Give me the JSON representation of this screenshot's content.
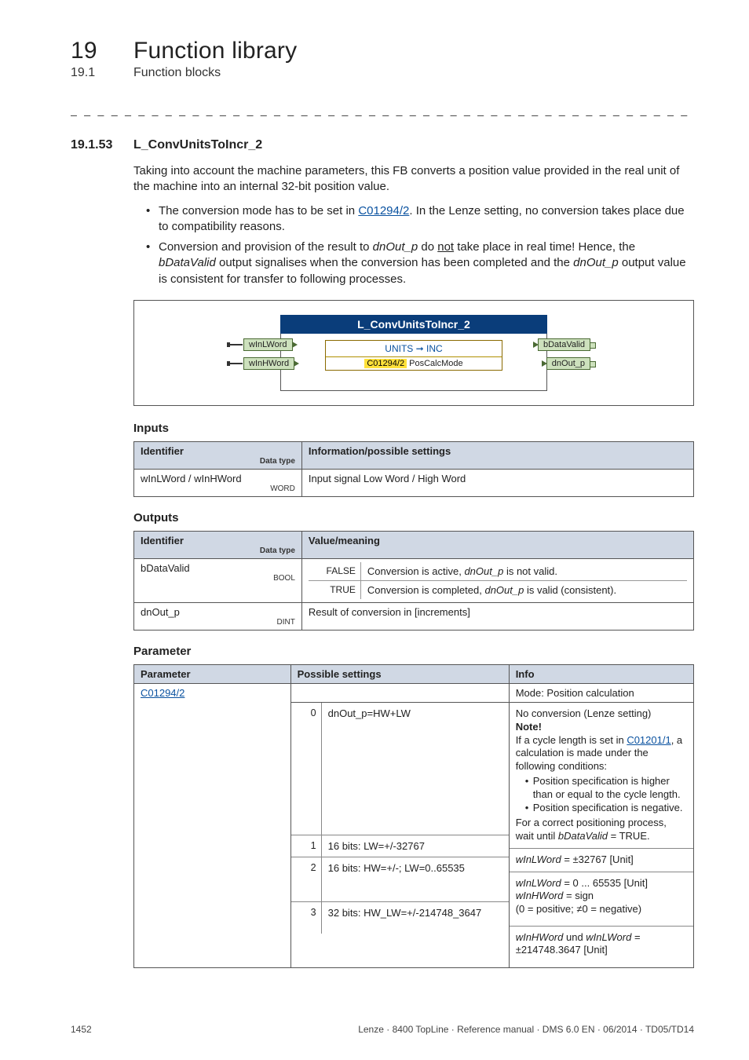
{
  "header": {
    "chapter_num": "19",
    "chapter_title": "Function library",
    "sub_num": "19.1",
    "sub_title": "Function blocks"
  },
  "section": {
    "num": "19.1.53",
    "title": "L_ConvUnitsToIncr_2",
    "intro": "Taking into account the machine parameters, this FB converts a position value provided in the real unit of the machine into an internal 32-bit position value.",
    "bullets": [
      {
        "pre": "The conversion mode has to be set in ",
        "link": "C01294/2",
        "post": ". In the Lenze setting, no conversion takes place due to compatibility reasons."
      },
      {
        "text_full": "Conversion and provision of the result to dnOut_p do not take place in real time! Hence, the bDataValid output signalises when the conversion has been completed and the dnOut_p output value is consistent for transfer to following processes."
      }
    ]
  },
  "diagram": {
    "title": "L_ConvUnitsToIncr_2",
    "in1": "wInLWord",
    "in2": "wInHWord",
    "out1": "bDataValid",
    "out2": "dnOut_p",
    "mid_top": "UNITS ➞ INC",
    "mid_code": "C01294/2",
    "mid_label": "PosCalcMode"
  },
  "inputs": {
    "heading": "Inputs",
    "col1": "Identifier",
    "col1_sub": "Data type",
    "col2": "Information/possible settings",
    "rows": [
      {
        "id": "wInLWord / wInHWord",
        "type": "WORD",
        "info": "Input signal Low Word / High Word"
      }
    ]
  },
  "outputs": {
    "heading": "Outputs",
    "col1": "Identifier",
    "col1_sub": "Data type",
    "col2": "Value/meaning",
    "rows": [
      {
        "id": "bDataValid",
        "type": "BOOL",
        "pairs": [
          {
            "k": "FALSE",
            "v": "Conversion is active, dnOut_p is not valid."
          },
          {
            "k": "TRUE",
            "v": "Conversion is completed, dnOut_p is valid (consistent)."
          }
        ]
      },
      {
        "id": "dnOut_p",
        "type": "DINT",
        "info": "Result of conversion in [increments]"
      }
    ]
  },
  "params": {
    "heading": "Parameter",
    "col1": "Parameter",
    "col2": "Possible settings",
    "col3": "Info",
    "param_link": "C01294/2",
    "mode_info": "Mode: Position calculation",
    "options": [
      {
        "n": "0",
        "setting": "dnOut_p=HW+LW",
        "info_lines": {
          "l1": "No conversion (Lenze setting)",
          "note": "Note!",
          "l2a": "If a cycle length is set in ",
          "l2link": "C01201/1",
          "l2b": ", a calculation is made under the following conditions:",
          "sub": [
            "Position specification is higher than or equal to the cycle length.",
            "Position specification is negative."
          ],
          "l3": "For a correct positioning process, wait until bDataValid = TRUE."
        }
      },
      {
        "n": "1",
        "setting": "16 bits: LW=+/-32767",
        "info": "wInLWord = ±32767 [Unit]"
      },
      {
        "n": "2",
        "setting": "16 bits: HW=+/-; LW=0..65535",
        "info_multi": [
          "wInLWord = 0 ... 65535 [Unit]",
          "wInHWord = sign",
          "(0 = positive; ≠0 = negative)"
        ]
      },
      {
        "n": "3",
        "setting": "32 bits: HW_LW=+/-214748_3647",
        "info_multi": [
          "wInHWord und wInLWord = ±214748.3647 [Unit]"
        ]
      }
    ]
  },
  "footer": {
    "page": "1452",
    "right": "Lenze · 8400 TopLine · Reference manual · DMS 6.0 EN · 06/2014 · TD05/TD14"
  }
}
